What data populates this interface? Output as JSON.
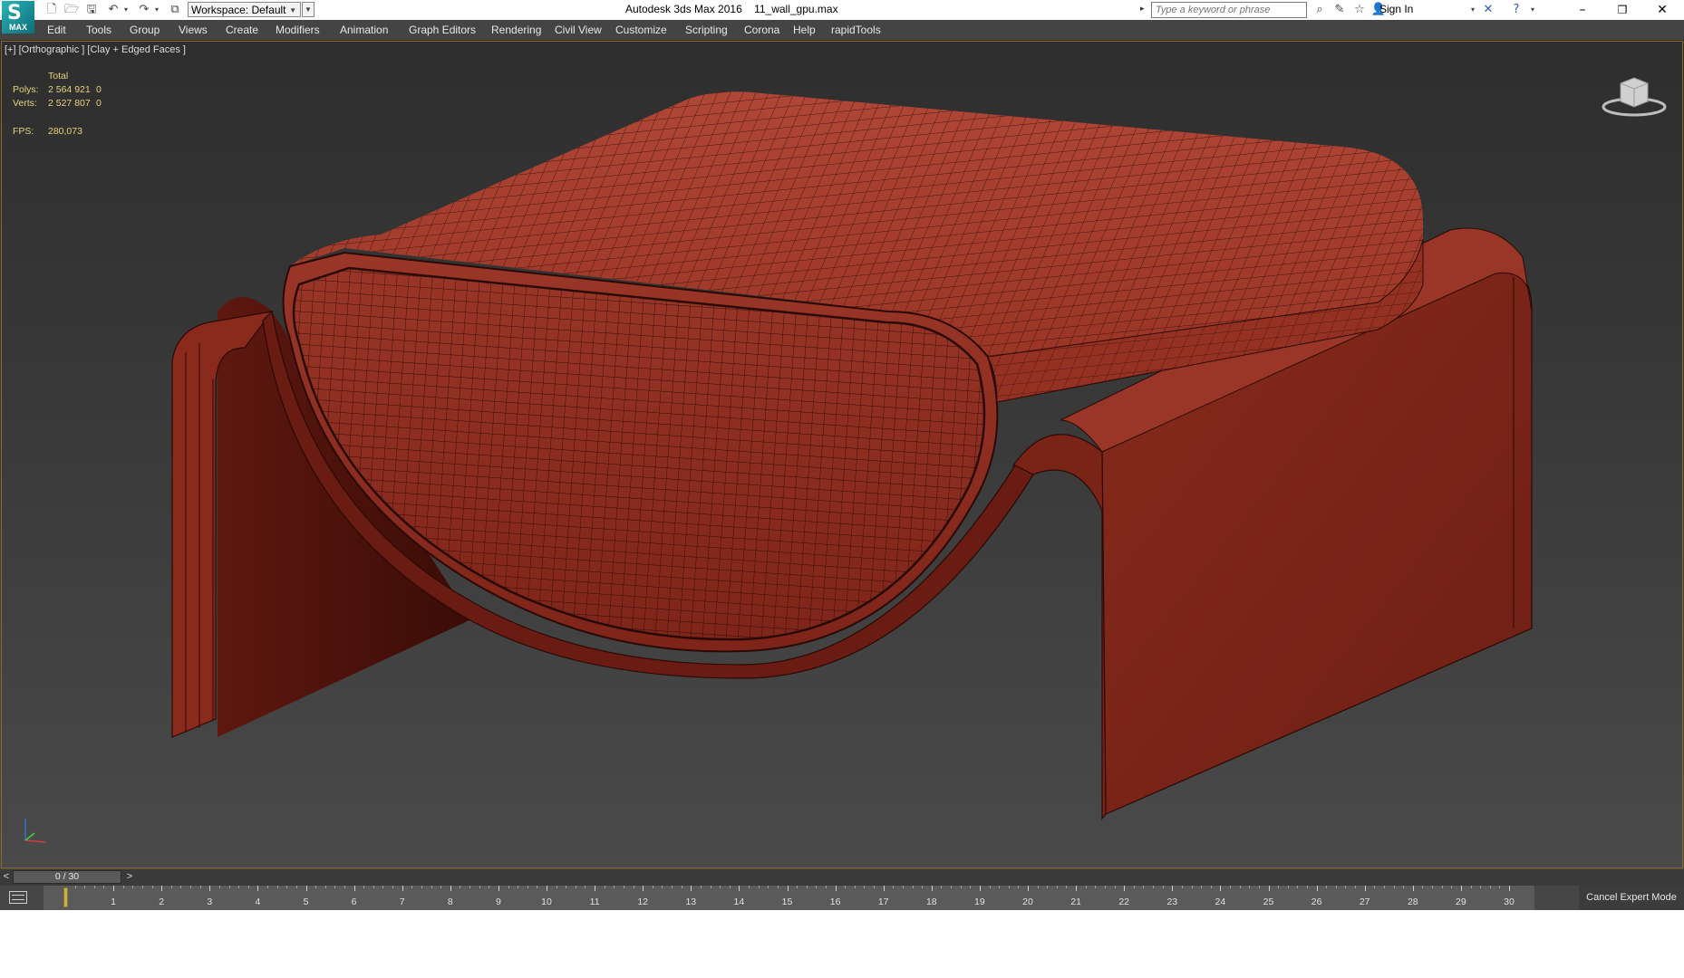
{
  "app": {
    "logo_text": "MAX",
    "title": "Autodesk 3ds Max 2016    11_wall_gpu.max",
    "workspace": "Workspace: Default",
    "search_placeholder": "Type a keyword or phrase",
    "sign_in": "Sign In",
    "window_controls": {
      "minimize": "–",
      "restore": "❐",
      "close": "✕"
    }
  },
  "quick_access_icons": [
    "new-file-icon",
    "open-file-icon",
    "save-icon",
    "undo-icon",
    "redo-icon",
    "project-folder-icon"
  ],
  "menubar": {
    "items": [
      "Edit",
      "Tools",
      "Group",
      "Views",
      "Create",
      "Modifiers",
      "Animation",
      "Graph Editors",
      "Rendering",
      "Civil View",
      "Customize",
      "Scripting",
      "Corona",
      "Help",
      "rapidTools"
    ]
  },
  "viewport": {
    "label": "[+] [Orthographic ] [Clay + Edged Faces ]",
    "stats": {
      "header": "Total",
      "polys_label": "Polys:",
      "polys_value": "2 564 921",
      "polys_sel": "0",
      "verts_label": "Verts:",
      "verts_value": "2 527 807",
      "verts_sel": "0",
      "fps_label": "FPS:",
      "fps_value": "280,073"
    },
    "model_color": "#8a2a1e",
    "wire_color": "#2a0a06"
  },
  "timeline": {
    "thumb": "0 / 30",
    "prev": "<",
    "next": ">",
    "current": 0,
    "end": 30,
    "cancel_expert": "Cancel Expert Mode"
  }
}
